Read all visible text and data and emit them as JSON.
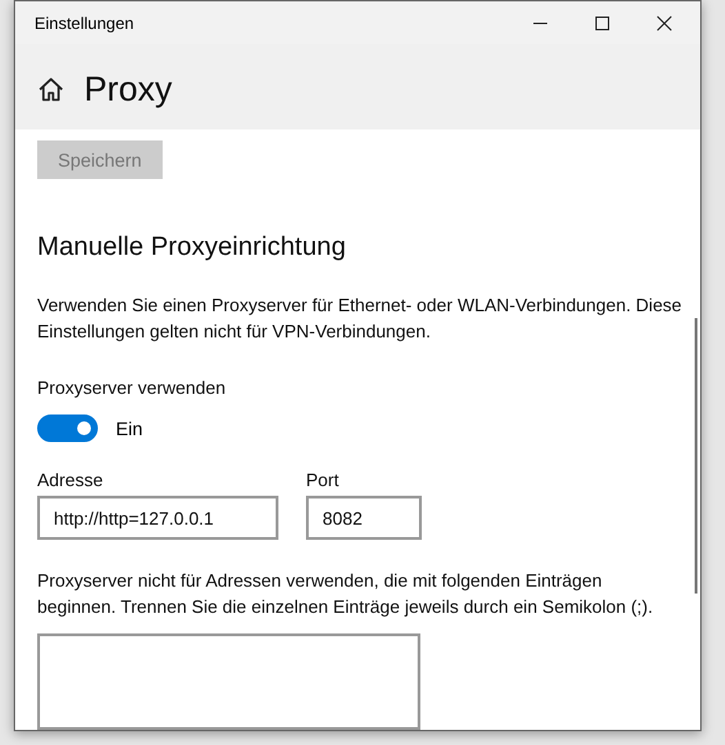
{
  "window": {
    "title": "Einstellungen"
  },
  "page": {
    "title": "Proxy"
  },
  "save_button": {
    "label": "Speichern",
    "disabled": true
  },
  "section": {
    "title": "Manuelle Proxyeinrichtung",
    "description": "Verwenden Sie einen Proxyserver für Ethernet- oder WLAN-Verbindungen. Diese Einstellungen gelten nicht für VPN-Verbindungen."
  },
  "proxy_toggle": {
    "label": "Proxyserver verwenden",
    "on": true,
    "state_text": "Ein"
  },
  "address": {
    "label": "Adresse",
    "value": "http://http=127.0.0.1"
  },
  "port": {
    "label": "Port",
    "value": "8082"
  },
  "exceptions": {
    "description": "Proxyserver nicht für Adressen verwenden, die mit folgenden Einträgen beginnen. Trennen Sie die einzelnen Einträge jeweils durch ein Semikolon (;)."
  }
}
